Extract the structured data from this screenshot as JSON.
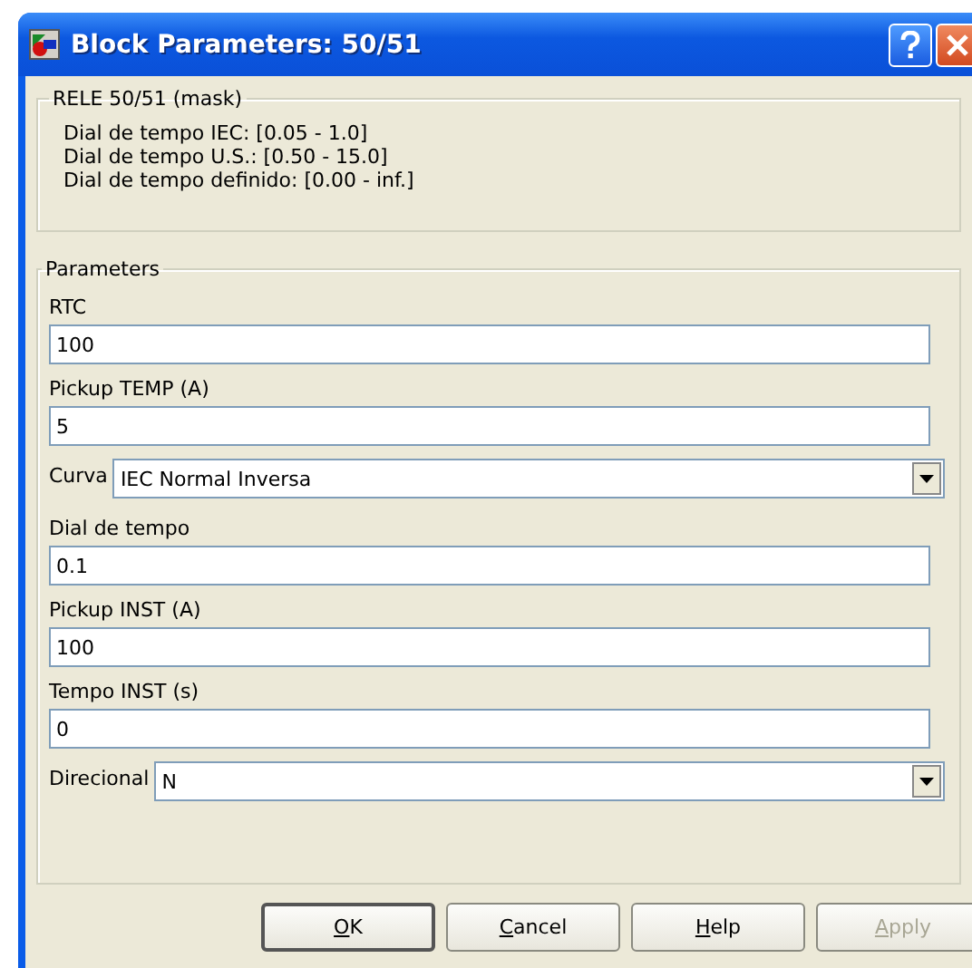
{
  "window": {
    "title": "Block Parameters: 50/51"
  },
  "mask": {
    "title": "RELE 50/51 (mask)",
    "lines": [
      "Dial de tempo IEC: [0.05 - 1.0]",
      "Dial de tempo U.S.: [0.50 - 15.0]",
      "Dial de tempo definido: [0.00 - inf.]"
    ]
  },
  "parameters": {
    "title": "Parameters",
    "items": [
      {
        "kind": "edit",
        "label": "RTC",
        "value": "100"
      },
      {
        "kind": "edit",
        "label": "Pickup TEMP (A)",
        "value": "5"
      },
      {
        "kind": "popup",
        "label": "Curva",
        "value": "IEC Normal Inversa"
      },
      {
        "kind": "edit",
        "label": "Dial de tempo",
        "value": "0.1"
      },
      {
        "kind": "edit",
        "label": "Pickup INST (A)",
        "value": "100"
      },
      {
        "kind": "edit",
        "label": "Tempo INST (s)",
        "value": "0"
      },
      {
        "kind": "popup",
        "label": "Direcional",
        "value": "N"
      }
    ]
  },
  "buttons": [
    {
      "label": "OK",
      "disabled": false,
      "default": true
    },
    {
      "label": "Cancel",
      "disabled": false,
      "default": false
    },
    {
      "label": "Help",
      "disabled": false,
      "default": false
    },
    {
      "label": "Apply",
      "disabled": true,
      "default": false
    }
  ]
}
